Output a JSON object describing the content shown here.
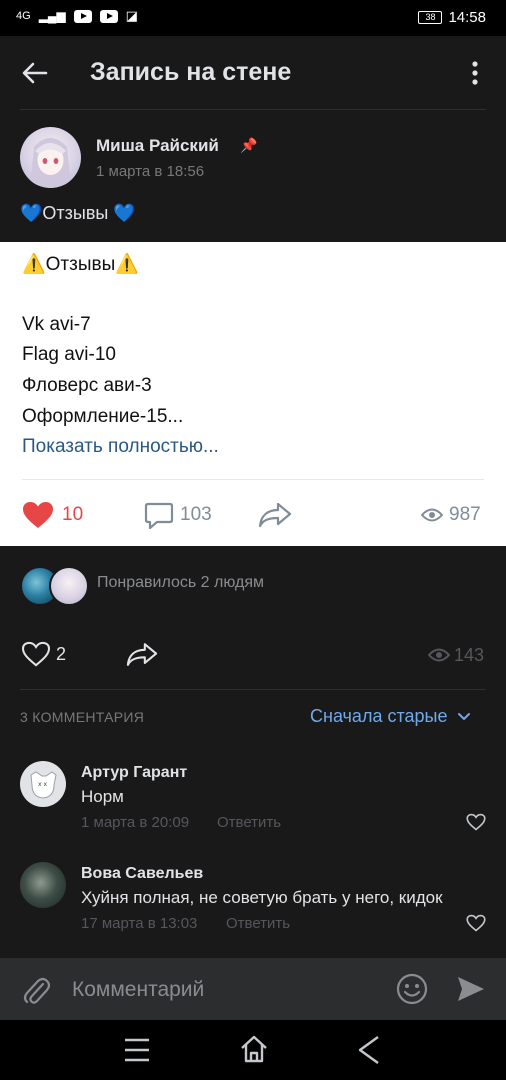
{
  "status_bar": {
    "network": "4G",
    "signal": "3G",
    "battery": "38",
    "time": "14:58"
  },
  "header": {
    "title": "Запись на стене"
  },
  "post": {
    "author": "Миша Райский",
    "date": "1 марта в 18:56",
    "caption": "💙Отзывы 💙",
    "repost_title": "⚠️Отзывы⚠️",
    "lines": [
      "Vk avi-7",
      "Flag avi-10",
      "Фловерс ави-3",
      "Оформление-15..."
    ],
    "show_more": "Показать полностью...",
    "likes": "10",
    "comments": "103",
    "views": "987"
  },
  "liked_by": {
    "text": "Понравилось 2 людям"
  },
  "post_stats": {
    "likes": "2",
    "views": "143"
  },
  "comments_section": {
    "title": "3 КОММЕНТАРИЯ",
    "sort": "Сначала старые"
  },
  "comments": [
    {
      "author": "Артур Гарант",
      "text": "Норм",
      "date": "1 марта в 20:09",
      "reply": "Ответить"
    },
    {
      "author": "Вова Савельев",
      "text": "Хуйня полная, не советую брать у него, кидок",
      "date": "17 марта в 13:03",
      "reply": "Ответить"
    }
  ],
  "input": {
    "placeholder": "Комментарий"
  },
  "colors": {
    "accent": "#71aaeb",
    "like_red": "#e64646",
    "background": "#19191a",
    "card": "#ffffff"
  }
}
